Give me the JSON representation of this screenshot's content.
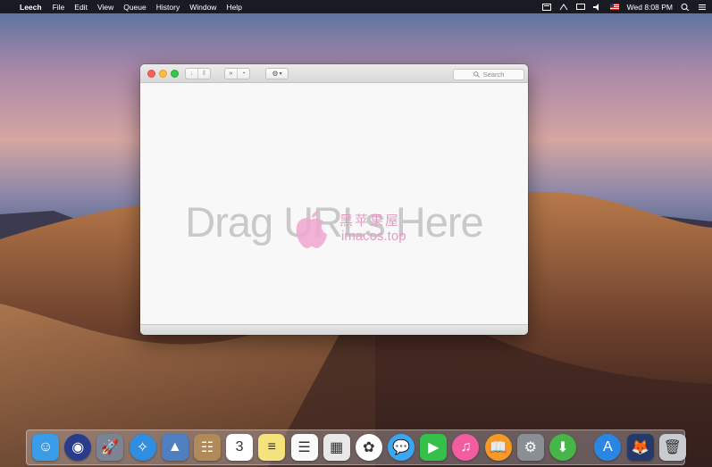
{
  "menubar": {
    "apple_symbol": "",
    "app_name": "Leech",
    "items": [
      "File",
      "Edit",
      "View",
      "Queue",
      "History",
      "Window",
      "Help"
    ],
    "clock": "Wed 8:08 PM",
    "status_icons": [
      "notification-icon",
      "airdrop-icon",
      "display-icon",
      "volume-icon",
      "us-flag-icon",
      "spotlight-icon",
      "notification-center-icon"
    ]
  },
  "window": {
    "toolbar": {
      "play_symbol": "↓",
      "pause_symbol": "‖",
      "skip_symbol": "»",
      "speed_symbol": "◔",
      "gear_symbol": "⚙",
      "gear_chevron": "▾"
    },
    "search": {
      "label": "Search",
      "icon": "magnifier-icon"
    },
    "drop_hint": "Drag URLs Here"
  },
  "watermark": {
    "title": "黑苹果屋",
    "url": "imacos.top"
  },
  "dock": {
    "apps": [
      {
        "name": "finder",
        "glyph": "☺",
        "bg": "#3a9be6"
      },
      {
        "name": "siri",
        "glyph": "◉",
        "bg": "#2b3b8c"
      },
      {
        "name": "launchpad",
        "glyph": "🚀",
        "bg": "#7a8494"
      },
      {
        "name": "safari",
        "glyph": "✧",
        "bg": "#2f8ee0"
      },
      {
        "name": "photo-viewer",
        "glyph": "▲",
        "bg": "#4e7fc0"
      },
      {
        "name": "contacts",
        "glyph": "☷",
        "bg": "#b08a58"
      },
      {
        "name": "calendar",
        "glyph": "3",
        "bg": "#ffffff"
      },
      {
        "name": "notes",
        "glyph": "≡",
        "bg": "#f6e27a"
      },
      {
        "name": "reminders",
        "glyph": "☰",
        "bg": "#fafafa"
      },
      {
        "name": "preview",
        "glyph": "▦",
        "bg": "#e8e8e8"
      },
      {
        "name": "photos",
        "glyph": "✿",
        "bg": "#ffffff"
      },
      {
        "name": "messages",
        "glyph": "💬",
        "bg": "#3aa7f0"
      },
      {
        "name": "facetime",
        "glyph": "▶",
        "bg": "#35c04a"
      },
      {
        "name": "itunes",
        "glyph": "♫",
        "bg": "#f45ca0"
      },
      {
        "name": "ibooks",
        "glyph": "📖",
        "bg": "#f39a27"
      },
      {
        "name": "system-preferences",
        "glyph": "⚙",
        "bg": "#8a8f96"
      },
      {
        "name": "leech",
        "glyph": "⬇",
        "bg": "#46b648"
      }
    ],
    "trailing": [
      {
        "name": "app-store",
        "glyph": "A",
        "bg": "#2a86e5"
      },
      {
        "name": "downloads-stack",
        "glyph": "🦊",
        "bg": "#253a6a"
      },
      {
        "name": "trash",
        "glyph": "🗑",
        "bg": "#c8ccd0"
      }
    ]
  }
}
